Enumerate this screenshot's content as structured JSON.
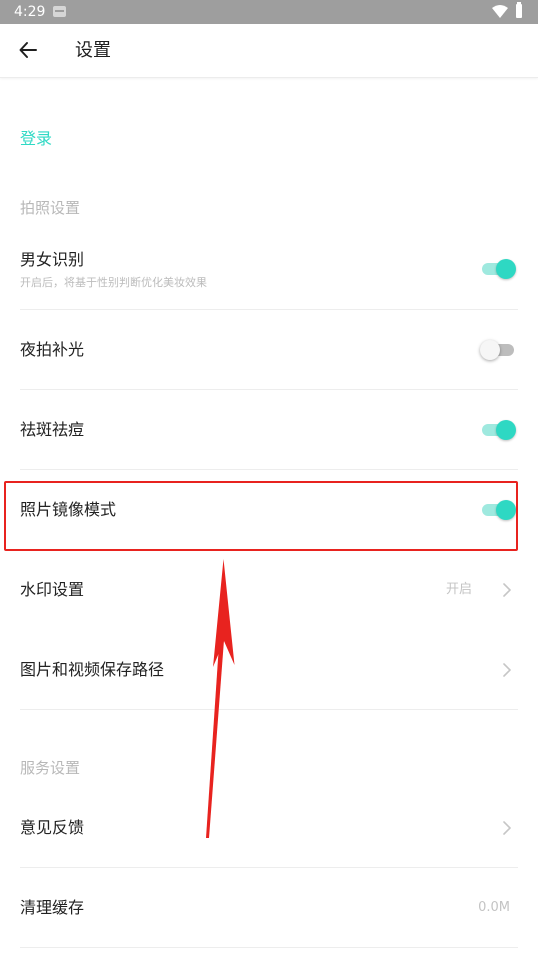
{
  "status_bar": {
    "time": "4:29",
    "icons": [
      "notification-icon",
      "wifi-icon",
      "battery-icon"
    ]
  },
  "toolbar": {
    "back_icon": "arrow-left-icon",
    "title": "设置"
  },
  "login": {
    "label": "登录"
  },
  "sections": {
    "camera": {
      "header": "拍照设置",
      "gender": {
        "title": "男女识别",
        "subtitle": "开启后，将基于性别判断优化美妆效果",
        "enabled": true
      },
      "night_fill": {
        "title": "夜拍补光",
        "enabled": false
      },
      "blemish": {
        "title": "祛斑祛痘",
        "enabled": true
      },
      "mirror": {
        "title": "照片镜像模式",
        "enabled": true
      },
      "watermark": {
        "title": "水印设置",
        "value": "开启"
      },
      "save_path": {
        "title": "图片和视频保存路径"
      }
    },
    "service": {
      "header": "服务设置",
      "feedback": {
        "title": "意见反馈"
      },
      "cache": {
        "title": "清理缓存",
        "value": "0.0M"
      }
    }
  },
  "colors": {
    "accent": "#2fd9c4",
    "annotation": "#e8231f"
  }
}
